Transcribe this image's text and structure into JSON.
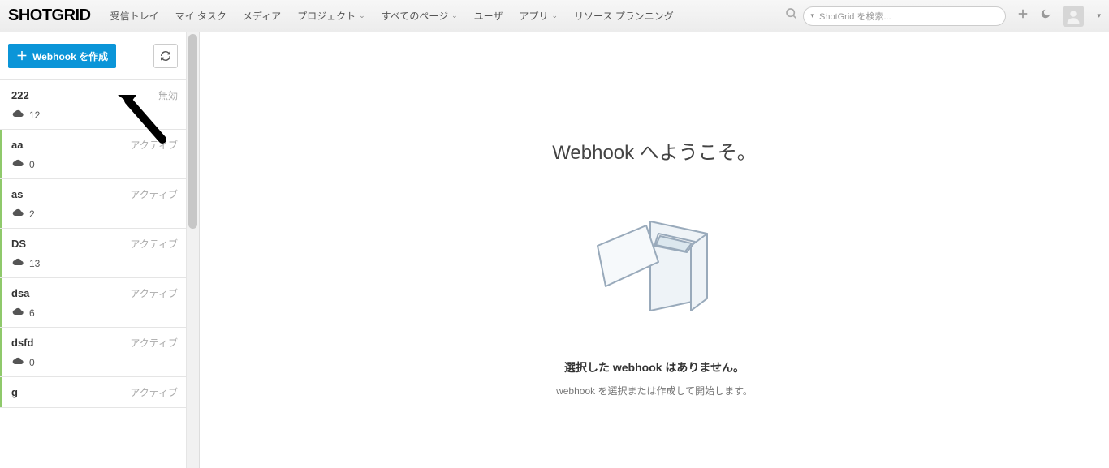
{
  "logo": "SHOTGRID",
  "nav": [
    {
      "label": "受信トレイ",
      "dropdown": false
    },
    {
      "label": "マイ タスク",
      "dropdown": false
    },
    {
      "label": "メディア",
      "dropdown": false
    },
    {
      "label": "プロジェクト",
      "dropdown": true
    },
    {
      "label": "すべてのページ",
      "dropdown": true
    },
    {
      "label": "ユーザ",
      "dropdown": false
    },
    {
      "label": "アプリ",
      "dropdown": true
    },
    {
      "label": "リソース プランニング",
      "dropdown": false
    }
  ],
  "search": {
    "placeholder": "ShotGrid を検索..."
  },
  "sidebar": {
    "create_label": "Webhook を作成",
    "items": [
      {
        "name": "222",
        "status": "無効",
        "count": "12",
        "active": false
      },
      {
        "name": "aa",
        "status": "アクティブ",
        "count": "0",
        "active": true
      },
      {
        "name": "as",
        "status": "アクティブ",
        "count": "2",
        "active": true
      },
      {
        "name": "DS",
        "status": "アクティブ",
        "count": "13",
        "active": true
      },
      {
        "name": "dsa",
        "status": "アクティブ",
        "count": "6",
        "active": true
      },
      {
        "name": "dsfd",
        "status": "アクティブ",
        "count": "0",
        "active": true
      },
      {
        "name": "g",
        "status": "アクティブ",
        "count": "",
        "active": true
      }
    ]
  },
  "content": {
    "welcome": "Webhook へようこそ。",
    "empty_heading": "選択した webhook はありません。",
    "empty_sub": "webhook を選択または作成して開始します。"
  }
}
